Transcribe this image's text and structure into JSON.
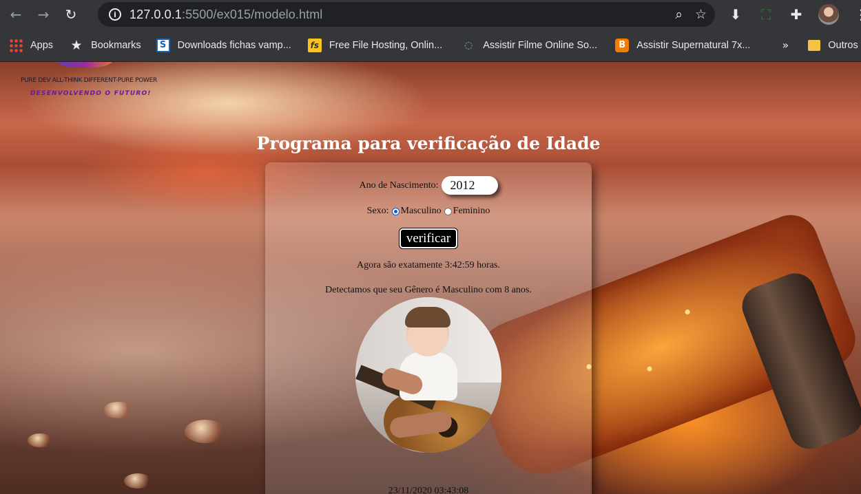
{
  "browser": {
    "url_host": "127.0.0.1",
    "url_path": ":5500/ex015/modelo.html",
    "bookmarks": [
      {
        "label": "Apps"
      },
      {
        "label": "Bookmarks"
      },
      {
        "label": "Downloads fichas vamp..."
      },
      {
        "label": "Free File Hosting, Onlin..."
      },
      {
        "label": "Assistir Filme Online So..."
      },
      {
        "label": "Assistir Supernatural 7x..."
      }
    ],
    "overflow_label": "»",
    "other_bookmarks": "Outros favoritos"
  },
  "logo": {
    "line1": "PURE DEV ALL-THINK DIFFERENT-PURE POWER",
    "line2": "DESENVOLVENDO O FUTURO!"
  },
  "page": {
    "title": "Programa para verificação de Idade",
    "year_label": "Ano de Nascimento:",
    "year_value": "2012",
    "sex_label": "Sexo:",
    "sex_options": [
      {
        "label": "Masculino",
        "selected": true
      },
      {
        "label": "Feminino",
        "selected": false
      }
    ],
    "verify_button": "verificar",
    "time_text": "Agora são exatamente 3:42:59 horas.",
    "result_text": "Detectamos que seu Gênero é Masculino com 8 anos.",
    "footer_date": "23/11/2020 03:43:08"
  },
  "colors": {
    "chrome_bg": "#35363a",
    "omnibox_bg": "#202124",
    "radio_accent": "#0b57d0",
    "button_bg": "#000000"
  }
}
